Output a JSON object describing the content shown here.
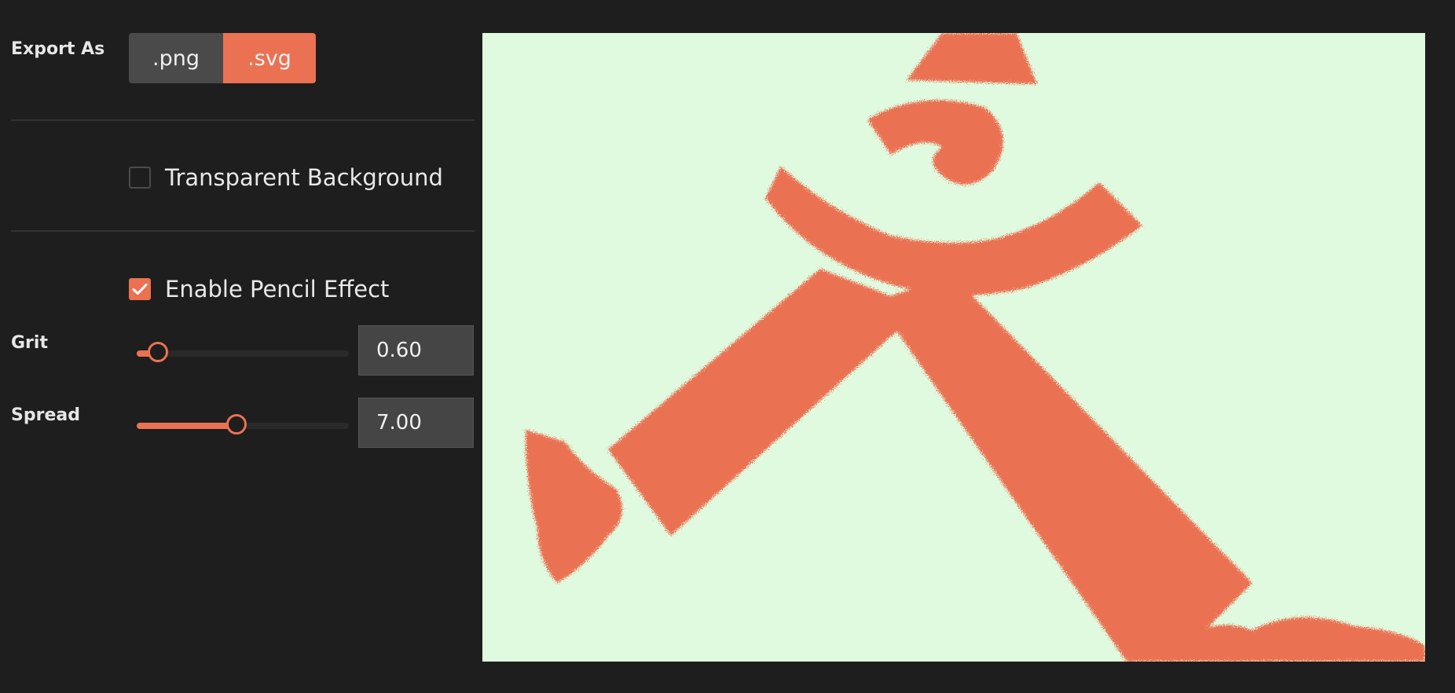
{
  "export": {
    "label": "Export As",
    "options": [
      ".png",
      ".svg"
    ],
    "selected": ".svg"
  },
  "transparent_background": {
    "label": "Transparent Background",
    "checked": false
  },
  "pencil_effect": {
    "label": "Enable Pencil Effect",
    "checked": true
  },
  "grit": {
    "label": "Grit",
    "value": "0.60",
    "level": 0.1
  },
  "spread": {
    "label": "Spread",
    "value": "7.00",
    "level": 0.47
  },
  "colors": {
    "accent": "#ea7253",
    "panel_bg": "#1e1e1e",
    "canvas_bg": "#dffadf"
  },
  "icons": {
    "checkmark": "checkmark-icon"
  }
}
